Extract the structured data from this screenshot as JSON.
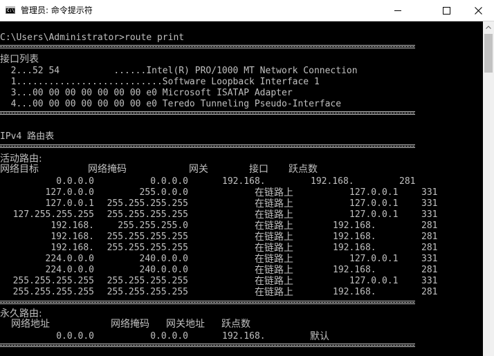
{
  "window": {
    "title": "管理员: 命令提示符",
    "icon_label": "C:\\"
  },
  "console": {
    "command": "C:\\Users\\Administrator>route print",
    "interface_list_title": "接口列表",
    "interfaces": [
      "  2...52 54          ......Intel(R) PRO/1000 MT Network Connection",
      "  1...........................Software Loopback Interface 1",
      "  3...00 00 00 00 00 00 00 e0 Microsoft ISATAP Adapter",
      "  4...00 00 00 00 00 00 00 e0 Teredo Tunneling Pseudo-Interface"
    ],
    "ipv4_title": "IPv4 路由表",
    "active_routes_title": "活动路由:",
    "active_headers": [
      "网络目标",
      "网络掩码",
      "网关",
      "接口",
      "跃点数"
    ],
    "active_routes": [
      {
        "dest": "0.0.0.0",
        "mask": "0.0.0.0",
        "gateway": "192.168.",
        "iface": "192.168.",
        "metric": "281"
      },
      {
        "dest": "127.0.0.0",
        "mask": "255.0.0.0",
        "gateway": "在链路上",
        "iface": "127.0.0.1",
        "metric": "331"
      },
      {
        "dest": "127.0.0.1",
        "mask": "255.255.255.255",
        "gateway": "在链路上",
        "iface": "127.0.0.1",
        "metric": "331"
      },
      {
        "dest": "127.255.255.255",
        "mask": "255.255.255.255",
        "gateway": "在链路上",
        "iface": "127.0.0.1",
        "metric": "331"
      },
      {
        "dest": "192.168.",
        "mask": "255.255.255.0",
        "gateway": "在链路上",
        "iface": "192.168.",
        "metric": "281"
      },
      {
        "dest": "192.168.",
        "mask": "255.255.255.255",
        "gateway": "在链路上",
        "iface": "192.168.",
        "metric": "281"
      },
      {
        "dest": "192.168.",
        "mask": "255.255.255.255",
        "gateway": "在链路上",
        "iface": "192.168.",
        "metric": "281"
      },
      {
        "dest": "224.0.0.0",
        "mask": "240.0.0.0",
        "gateway": "在链路上",
        "iface": "127.0.0.1",
        "metric": "331"
      },
      {
        "dest": "224.0.0.0",
        "mask": "240.0.0.0",
        "gateway": "在链路上",
        "iface": "192.168.",
        "metric": "281"
      },
      {
        "dest": "255.255.255.255",
        "mask": "255.255.255.255",
        "gateway": "在链路上",
        "iface": "127.0.0.1",
        "metric": "331"
      },
      {
        "dest": "255.255.255.255",
        "mask": "255.255.255.255",
        "gateway": "在链路上",
        "iface": "192.168.",
        "metric": "281"
      }
    ],
    "persistent_routes_title": "永久路由:",
    "persistent_headers": [
      "网络地址",
      "网络掩码",
      "网关地址",
      "跃点数"
    ],
    "persistent_routes": [
      {
        "addr": "0.0.0.0",
        "mask": "0.0.0.0",
        "gateway": "192.168.",
        "metric": "默认"
      }
    ]
  }
}
